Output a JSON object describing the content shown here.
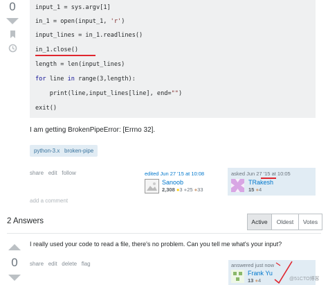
{
  "question": {
    "vote_count": "0",
    "code_lines": [
      "input_1 = sys.argv[1]",
      "in_1 = open(input_1, 'r')",
      "input_lines = in_1.readlines()",
      "in_1.close()",
      "length = len(input_lines)",
      "for line in range(3,length):",
      "    print(line,input_lines[line], end=\"\")",
      "exit()"
    ],
    "body_text": "I am getting BrokenPipeError: [Errno 32].",
    "tags": [
      "python-3.x",
      "broken-pipe"
    ],
    "menu": {
      "share": "share",
      "edit": "edit",
      "follow": "follow"
    },
    "editor": {
      "action": "edited Jun 27 '15 at 10:08",
      "name": "Sanoob",
      "rep": "2,308",
      "gold": "3",
      "silver": "25",
      "bronze": "33"
    },
    "asker": {
      "action_prefix": "asked Jun 27 ",
      "action_highlight": "'15",
      "action_suffix": " at 10:05",
      "name": "TRakesh",
      "rep": "15",
      "bronze": "4"
    },
    "add_comment": "add a comment"
  },
  "answers_header": {
    "count_label": "2 Answers",
    "tabs": [
      "Active",
      "Oldest",
      "Votes"
    ]
  },
  "answer": {
    "vote_count": "0",
    "body_text": "I really used your code to read a file, there's no problem. Can you tell me what's your input?",
    "menu": {
      "share": "share",
      "edit": "edit",
      "delete": "delete",
      "flag": "flag"
    },
    "author": {
      "action": "answered just now",
      "name": "Frank Yu",
      "rep": "13",
      "bronze": "4"
    }
  },
  "watermark": "@51CTO博客",
  "colors": {
    "annotation_red": "#e0252e",
    "link": "#0077cc",
    "tag_bg": "#e1ecf4",
    "owner_bg": "#e1ecf4"
  }
}
